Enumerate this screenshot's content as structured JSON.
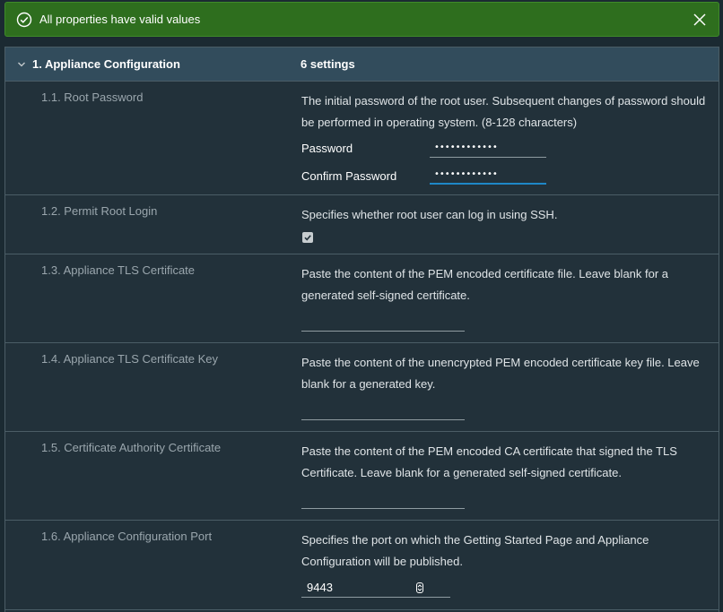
{
  "alert": {
    "message": "All properties have valid values",
    "icon": "check-circle-icon",
    "close_icon": "close-icon",
    "color": "#2e6e1e"
  },
  "section": {
    "title": "1. Appliance Configuration",
    "count": "6 settings",
    "expanded": true
  },
  "settings": [
    {
      "label": "1.1. Root Password",
      "description": "The initial password of the root user. Subsequent changes of password should be performed in operating system. (8-128 characters)",
      "password_label": "Password",
      "password_value": "••••••••••••",
      "confirm_label": "Confirm Password",
      "confirm_value": "••••••••••••"
    },
    {
      "label": "1.2. Permit Root Login",
      "description": "Specifies whether root user can log in using SSH.",
      "checked": true
    },
    {
      "label": "1.3. Appliance TLS Certificate",
      "description": "Paste the content of the PEM encoded certificate file. Leave blank for a generated self-signed certificate.",
      "value": ""
    },
    {
      "label": "1.4. Appliance TLS Certificate Key",
      "description": "Paste the content of the unencrypted PEM encoded certificate key file. Leave blank for a generated key.",
      "value": ""
    },
    {
      "label": "1.5. Certificate Authority Certificate",
      "description": "Paste the content of the PEM encoded CA certificate that signed the TLS Certificate. Leave blank for a generated self-signed certificate.",
      "value": ""
    },
    {
      "label": "1.6. Appliance Configuration Port",
      "description": "Specifies the port on which the Getting Started Page and Appliance Configuration will be published.",
      "value": "9443"
    }
  ]
}
